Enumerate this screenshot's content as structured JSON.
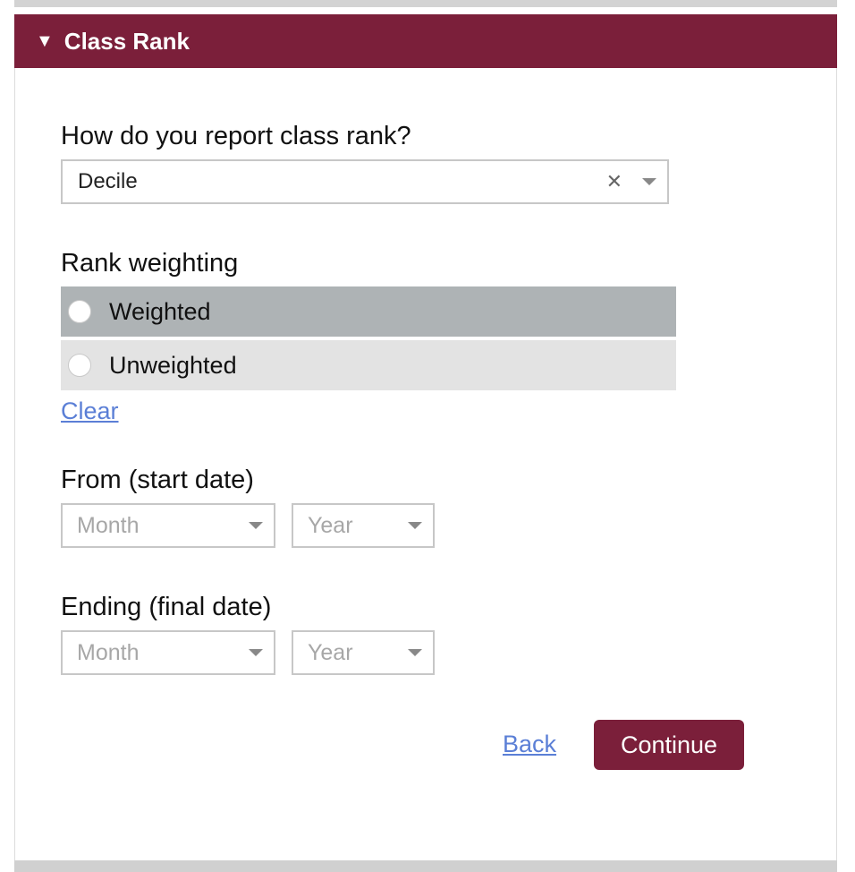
{
  "section": {
    "title": "Class Rank",
    "collapse_caret": "▼"
  },
  "class_rank": {
    "question": "How do you report class rank?",
    "selected": "Decile",
    "clear_symbol": "✕"
  },
  "rank_weighting": {
    "label": "Rank weighting",
    "options": [
      "Weighted",
      "Unweighted"
    ],
    "clear_link": "Clear"
  },
  "from_date": {
    "label": "From (start date)",
    "month_placeholder": "Month",
    "year_placeholder": "Year"
  },
  "ending_date": {
    "label": "Ending (final date)",
    "month_placeholder": "Month",
    "year_placeholder": "Year"
  },
  "actions": {
    "back": "Back",
    "continue": "Continue"
  },
  "colors": {
    "accent": "#7b1f3a",
    "link": "#5b7fd6",
    "radio_hover": "#aeb3b5",
    "radio_bg": "#e3e3e3"
  }
}
